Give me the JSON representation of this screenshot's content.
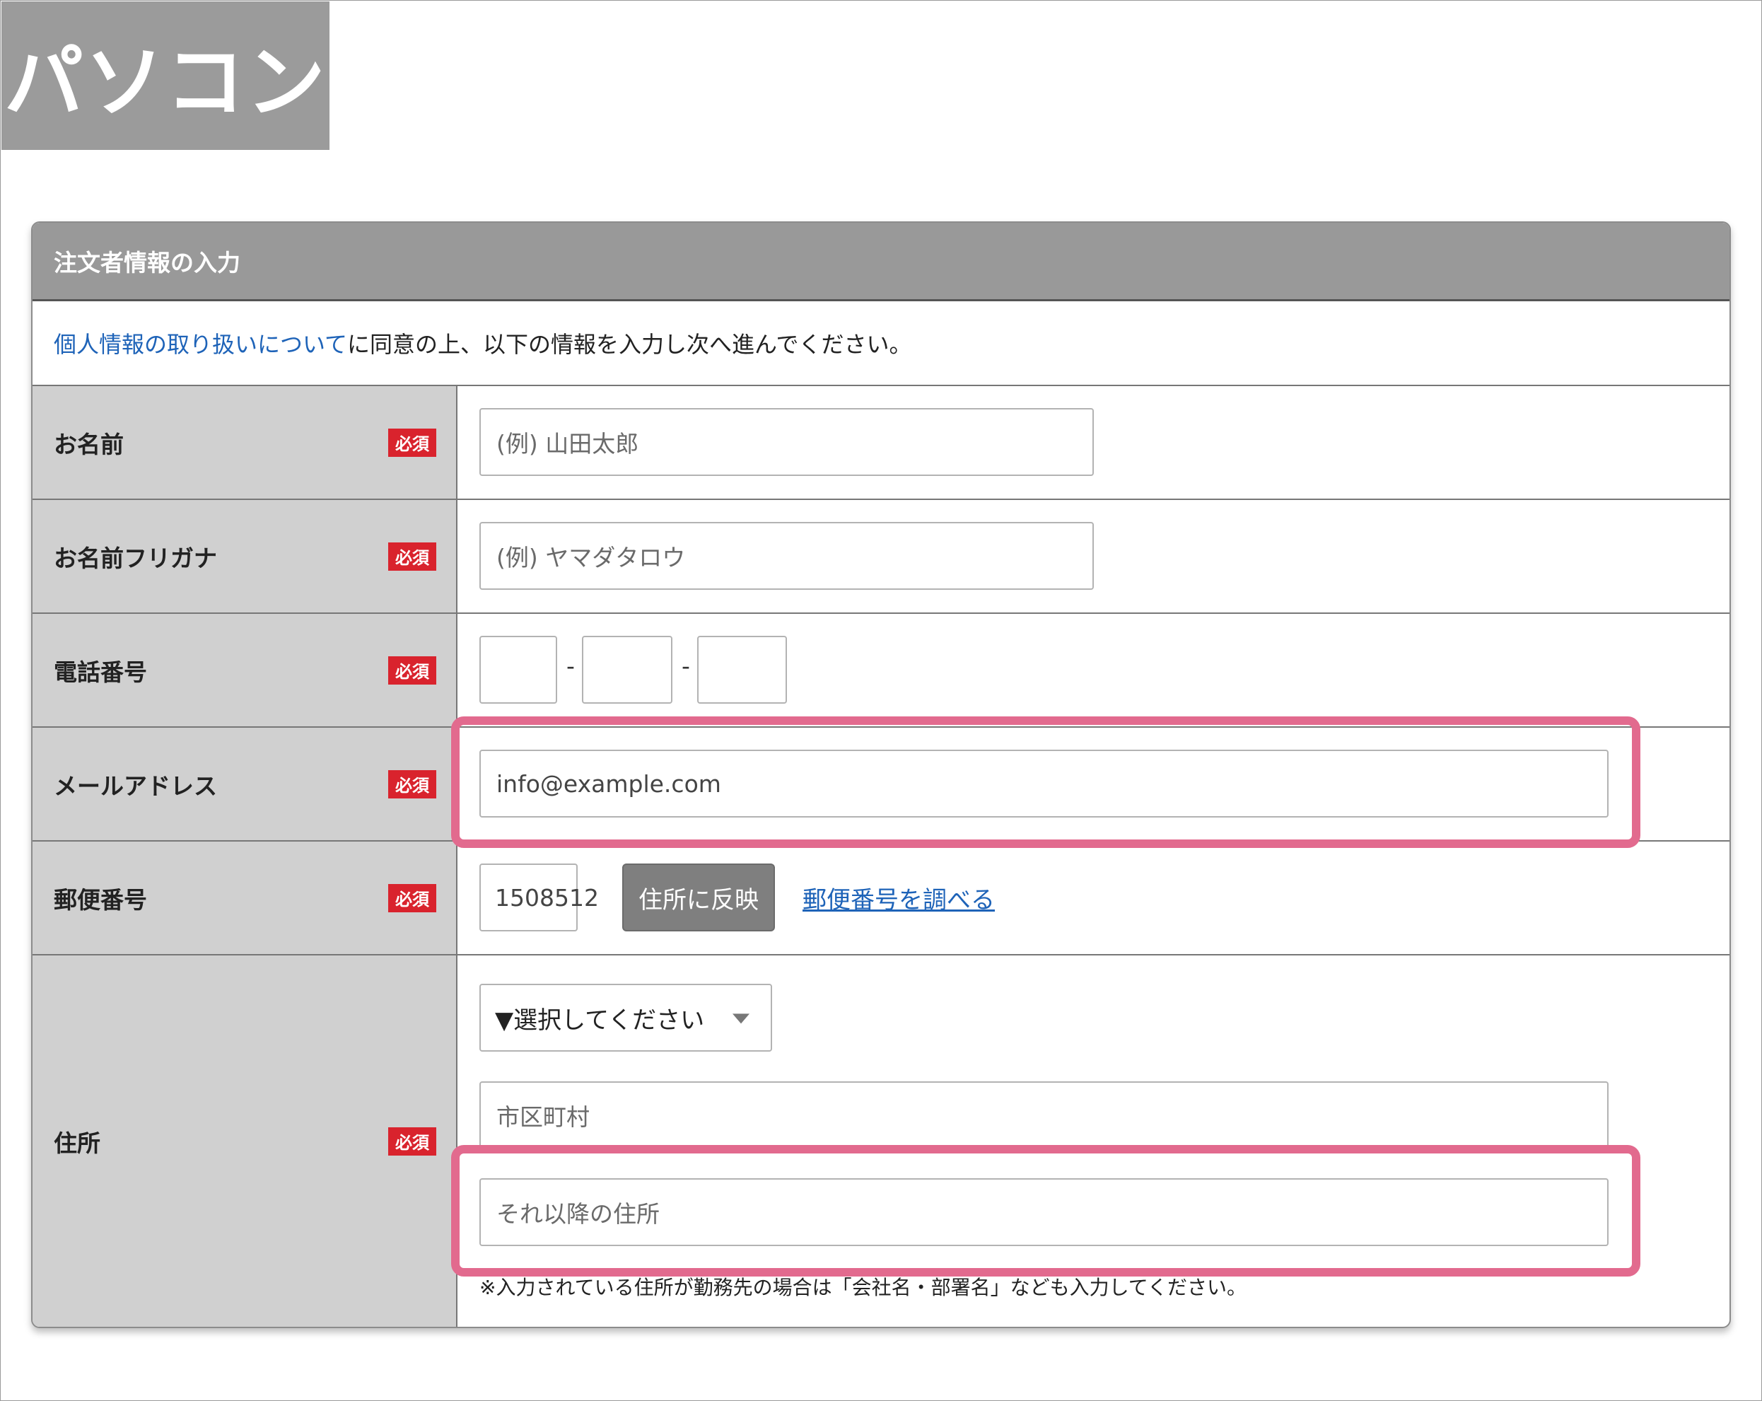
{
  "device_tag": "パソコン",
  "form": {
    "title": "注文者情報の入力",
    "intro": {
      "link_text": "個人情報の取り扱いについて",
      "rest_text": "に同意の上、以下の情報を入力し次へ進んでください。"
    },
    "required_badge": "必須",
    "fields": {
      "name": {
        "label": "お名前",
        "placeholder": "(例) 山田太郎"
      },
      "furigana": {
        "label": "お名前フリガナ",
        "placeholder": "(例) ヤマダタロウ"
      },
      "phone": {
        "label": "電話番号",
        "separator": "-",
        "part1": "",
        "part2": "",
        "part3": ""
      },
      "email": {
        "label": "メールアドレス",
        "value": "info@example.com"
      },
      "postal": {
        "label": "郵便番号",
        "value": "1508512",
        "reflect_button": "住所に反映",
        "lookup_link": "郵便番号を調べる"
      },
      "address": {
        "label": "住所",
        "prefecture_select": "▼選択してください",
        "city_placeholder": "市区町村",
        "rest_placeholder": "それ以降の住所",
        "note": "※入力されている住所が勤務先の場合は「会社名・部署名」なども入力してください。"
      }
    }
  },
  "highlight_color": "#e26a8e",
  "required_color": "#d9232d",
  "link_color": "#1e63b8"
}
